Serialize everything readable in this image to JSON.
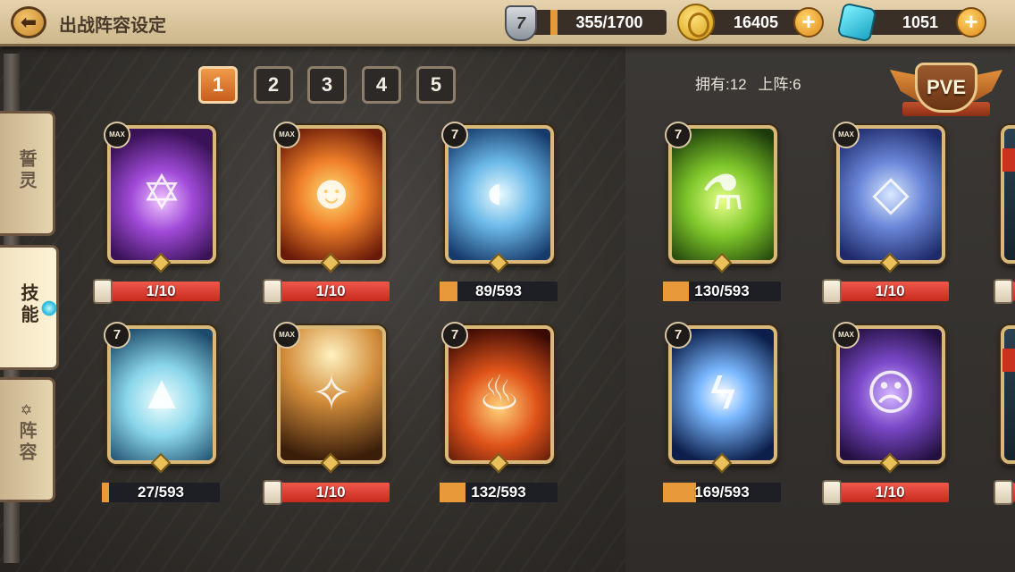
{
  "header": {
    "title": "出战阵容设定",
    "back_icon": "arrow-left-icon",
    "energy": {
      "badge": "7",
      "value": "355/1700",
      "fill_fraction": 0.21
    },
    "gold": {
      "value": "16405"
    },
    "gems": {
      "value": "1051"
    },
    "plus_label": "+"
  },
  "sidebar": {
    "tabs": [
      {
        "label": "誓灵",
        "active": false
      },
      {
        "label": "技能",
        "active": true
      },
      {
        "label": "阵容",
        "active": false,
        "icon": "star-icon"
      }
    ]
  },
  "pages": {
    "items": [
      "1",
      "2",
      "3",
      "4",
      "5"
    ],
    "selected": "1"
  },
  "counts": {
    "owned": "拥有:12",
    "deployed": "上阵:6"
  },
  "mode_badge": {
    "label": "PVE"
  },
  "colors": {
    "accent": "#e08a18",
    "bar_red": "#d8342a",
    "bar_progress": "#e89a3a",
    "frame_gold": "#d9b87a"
  },
  "cards": [
    {
      "badge": "MAX",
      "art": "purple-magic-circle",
      "bar": "1/10",
      "bar_type": "level"
    },
    {
      "badge": "MAX",
      "art": "fire-spirit",
      "bar": "1/10",
      "bar_type": "level"
    },
    {
      "badge": "7",
      "art": "water-shield",
      "bar": "89/593",
      "bar_type": "shards",
      "fill": 0.15
    },
    {
      "badge": "7",
      "art": "green-potion",
      "bar": "130/593",
      "bar_type": "shards",
      "fill": 0.22
    },
    {
      "badge": "MAX",
      "art": "crystal-prison",
      "bar": "1/10",
      "bar_type": "level"
    },
    {
      "badge": "7",
      "art": "ice-mountain",
      "bar": "27/593",
      "bar_type": "shards",
      "fill": 0.05
    },
    {
      "badge": "MAX",
      "art": "holy-light",
      "bar": "1/10",
      "bar_type": "level"
    },
    {
      "badge": "7",
      "art": "flame",
      "bar": "132/593",
      "bar_type": "shards",
      "fill": 0.22
    },
    {
      "badge": "7",
      "art": "lightning",
      "bar": "169/593",
      "bar_type": "shards",
      "fill": 0.28
    },
    {
      "badge": "MAX",
      "art": "purple-ghost",
      "bar": "1/10",
      "bar_type": "level"
    }
  ]
}
